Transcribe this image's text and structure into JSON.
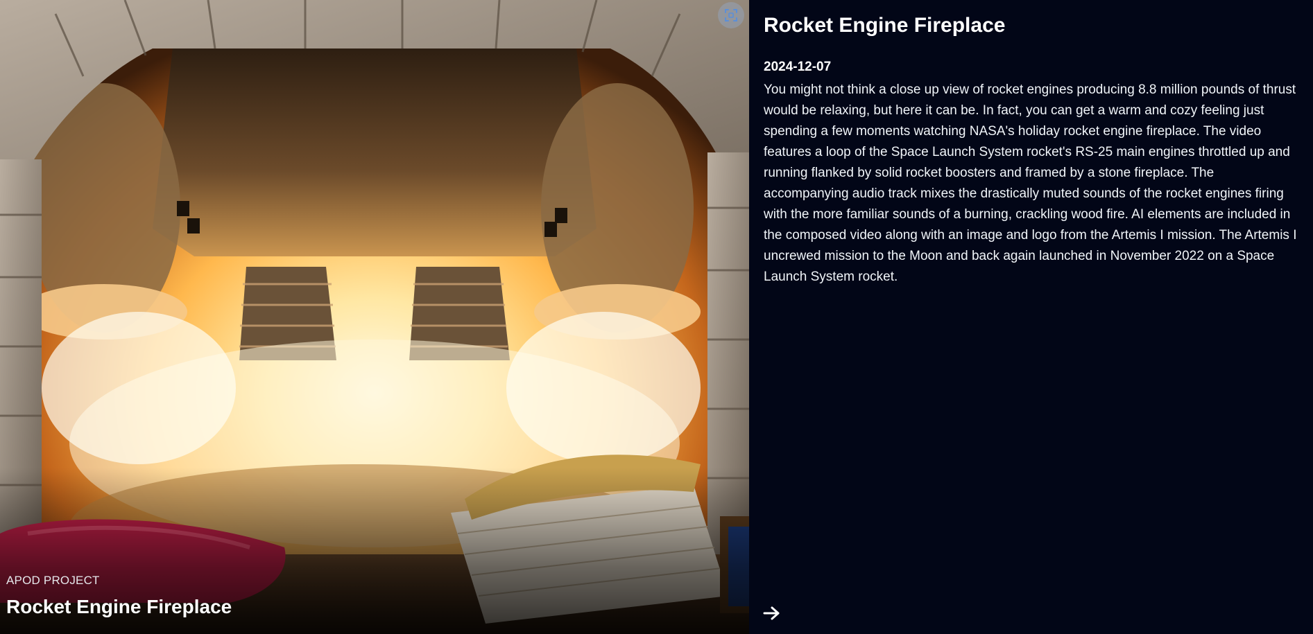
{
  "hero": {
    "kicker": "APOD PROJECT",
    "title": "Rocket Engine Fireplace",
    "expand_icon": "expand-icon"
  },
  "article": {
    "title": "Rocket Engine Fireplace",
    "date": "2024-12-07",
    "description": "You might not think a close up view of rocket engines producing 8.8 million pounds of thrust would be relaxing, but here it can be. In fact, you can get a warm and cozy feeling just spending a few moments watching NASA's holiday rocket engine fireplace. The video features a loop of the Space Launch System rocket's RS-25 main engines throttled up and running flanked by solid rocket boosters and framed by a stone fireplace. The accompanying audio track mixes the drastically muted sounds of the rocket engines firing with the more familiar sounds of a burning, crackling wood fire. AI elements are included in the composed video along with an image and logo from the Artemis I mission. The Artemis I uncrewed mission to the Moon and back again launched in November 2022 on a Space Launch System rocket."
  },
  "nav": {
    "next_icon": "arrow-right-icon"
  },
  "colors": {
    "background": "#020617",
    "text": "#f1f5f9",
    "flame": "#ffcf6a",
    "stone": "#9a8a7a"
  }
}
